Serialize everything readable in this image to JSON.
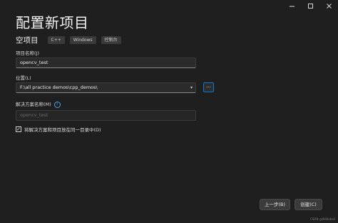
{
  "window": {
    "minimize_icon": "minimize-icon",
    "maximize_icon": "maximize-icon",
    "close_icon": "close-icon"
  },
  "header": {
    "title": "配置新项目",
    "subtitle": "空项目",
    "tags": [
      "C++",
      "Windows",
      "控制台"
    ]
  },
  "form": {
    "project_name_label": "项目名称(J)",
    "project_name_value": "opencv_test",
    "location_label": "位置(L)",
    "location_value": "F:\\all practice demos\\cpp_demos\\",
    "browse_label": "...",
    "solution_name_label": "解决方案名称(M)",
    "solution_name_placeholder": "opencv_test",
    "same_dir_checkbox_label": "将解决方案和项目放在同一目录中(D)",
    "same_dir_checked": true
  },
  "footer": {
    "back_button": "上一步(B)",
    "create_button": "创建(C)",
    "watermark": "CSDN @Wildoball"
  },
  "colors": {
    "background": "#1f1f1f",
    "accent": "#0a78d4"
  }
}
